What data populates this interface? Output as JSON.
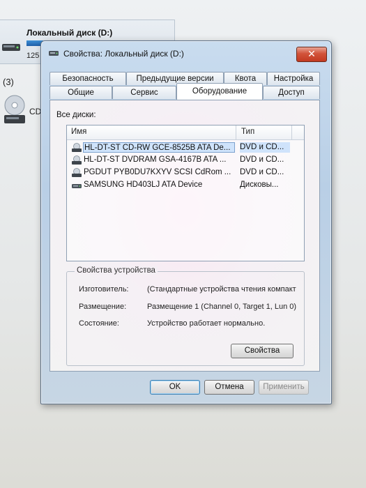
{
  "background": {
    "drive_title": "Локальный диск (D:)",
    "drive_size": "125",
    "section_count": "(3)",
    "cd_label": "CD"
  },
  "dialog": {
    "title": "Свойства: Локальный диск (D:)",
    "close_label": "✕",
    "tabs_row1": [
      "Безопасность",
      "Предыдущие версии",
      "Квота",
      "Настройка"
    ],
    "tabs_row2": [
      "Общие",
      "Сервис",
      "Оборудование",
      "Доступ"
    ],
    "active_tab": "Оборудование",
    "all_disks_label": "Все диски:",
    "list": {
      "columns": [
        "Имя",
        "Тип"
      ],
      "rows": [
        {
          "name": "HL-DT-ST CD-RW GCE-8525B ATA De...",
          "type": "DVD и CD...",
          "icon": "optical-drive-icon",
          "selected": true
        },
        {
          "name": "HL-DT-ST DVDRAM GSA-4167B ATA ...",
          "type": "DVD и CD...",
          "icon": "optical-drive-icon",
          "selected": false
        },
        {
          "name": "PGDUT PYB0DU7KXYV SCSI CdRom ...",
          "type": "DVD и CD...",
          "icon": "optical-drive-icon",
          "selected": false
        },
        {
          "name": "SAMSUNG HD403LJ ATA Device",
          "type": "Дисковы...",
          "icon": "hard-disk-icon",
          "selected": false
        }
      ]
    },
    "device_properties": {
      "title": "Свойства устройства",
      "manufacturer_label": "Изготовитель:",
      "manufacturer_value": "(Стандартные устройства чтения компакт",
      "location_label": "Размещение:",
      "location_value": "Размещение 1 (Channel 0, Target 1, Lun 0)",
      "status_label": "Состояние:",
      "status_value": "Устройство работает нормально.",
      "properties_button": "Свойства"
    },
    "buttons": {
      "ok": "OK",
      "cancel": "Отмена",
      "apply": "Применить"
    }
  }
}
